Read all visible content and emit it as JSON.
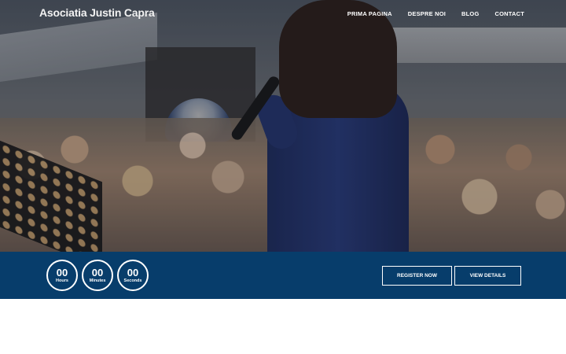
{
  "header": {
    "brand": "Asociatia Justin Capra",
    "nav": [
      "PRIMA PAGINA",
      "DESPRE NOI",
      "BLOG",
      "CONTACT"
    ]
  },
  "countdown": [
    {
      "value": "00",
      "label": "Hours"
    },
    {
      "value": "00",
      "label": "Minutes"
    },
    {
      "value": "00",
      "label": "Seconds"
    }
  ],
  "buttons": {
    "register": "REGISTER NOW",
    "details": "VIEW DETAILS"
  },
  "colors": {
    "band": "#073d6b",
    "text": "#ffffff"
  }
}
